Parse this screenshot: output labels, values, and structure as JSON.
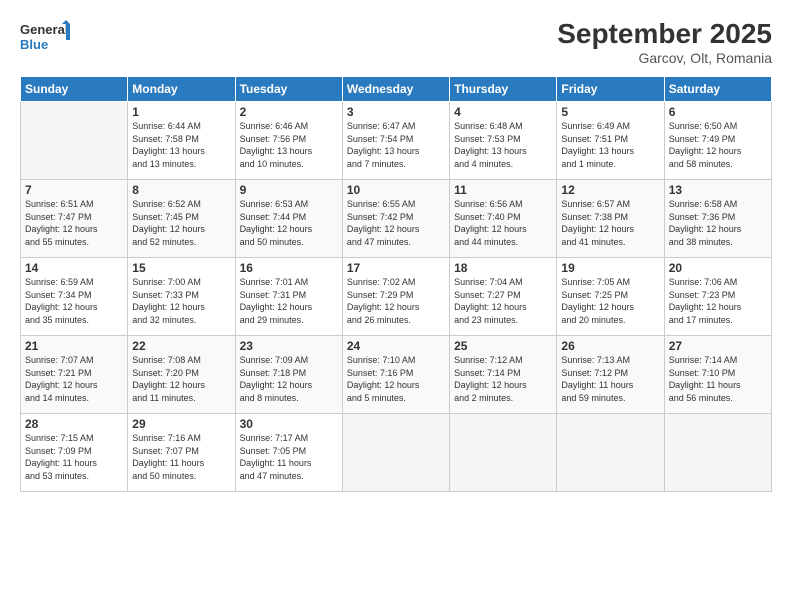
{
  "logo": {
    "line1": "General",
    "line2": "Blue"
  },
  "title": "September 2025",
  "subtitle": "Garcov, Olt, Romania",
  "headers": [
    "Sunday",
    "Monday",
    "Tuesday",
    "Wednesday",
    "Thursday",
    "Friday",
    "Saturday"
  ],
  "weeks": [
    [
      {
        "day": "",
        "info": ""
      },
      {
        "day": "1",
        "info": "Sunrise: 6:44 AM\nSunset: 7:58 PM\nDaylight: 13 hours\nand 13 minutes."
      },
      {
        "day": "2",
        "info": "Sunrise: 6:46 AM\nSunset: 7:56 PM\nDaylight: 13 hours\nand 10 minutes."
      },
      {
        "day": "3",
        "info": "Sunrise: 6:47 AM\nSunset: 7:54 PM\nDaylight: 13 hours\nand 7 minutes."
      },
      {
        "day": "4",
        "info": "Sunrise: 6:48 AM\nSunset: 7:53 PM\nDaylight: 13 hours\nand 4 minutes."
      },
      {
        "day": "5",
        "info": "Sunrise: 6:49 AM\nSunset: 7:51 PM\nDaylight: 13 hours\nand 1 minute."
      },
      {
        "day": "6",
        "info": "Sunrise: 6:50 AM\nSunset: 7:49 PM\nDaylight: 12 hours\nand 58 minutes."
      }
    ],
    [
      {
        "day": "7",
        "info": "Sunrise: 6:51 AM\nSunset: 7:47 PM\nDaylight: 12 hours\nand 55 minutes."
      },
      {
        "day": "8",
        "info": "Sunrise: 6:52 AM\nSunset: 7:45 PM\nDaylight: 12 hours\nand 52 minutes."
      },
      {
        "day": "9",
        "info": "Sunrise: 6:53 AM\nSunset: 7:44 PM\nDaylight: 12 hours\nand 50 minutes."
      },
      {
        "day": "10",
        "info": "Sunrise: 6:55 AM\nSunset: 7:42 PM\nDaylight: 12 hours\nand 47 minutes."
      },
      {
        "day": "11",
        "info": "Sunrise: 6:56 AM\nSunset: 7:40 PM\nDaylight: 12 hours\nand 44 minutes."
      },
      {
        "day": "12",
        "info": "Sunrise: 6:57 AM\nSunset: 7:38 PM\nDaylight: 12 hours\nand 41 minutes."
      },
      {
        "day": "13",
        "info": "Sunrise: 6:58 AM\nSunset: 7:36 PM\nDaylight: 12 hours\nand 38 minutes."
      }
    ],
    [
      {
        "day": "14",
        "info": "Sunrise: 6:59 AM\nSunset: 7:34 PM\nDaylight: 12 hours\nand 35 minutes."
      },
      {
        "day": "15",
        "info": "Sunrise: 7:00 AM\nSunset: 7:33 PM\nDaylight: 12 hours\nand 32 minutes."
      },
      {
        "day": "16",
        "info": "Sunrise: 7:01 AM\nSunset: 7:31 PM\nDaylight: 12 hours\nand 29 minutes."
      },
      {
        "day": "17",
        "info": "Sunrise: 7:02 AM\nSunset: 7:29 PM\nDaylight: 12 hours\nand 26 minutes."
      },
      {
        "day": "18",
        "info": "Sunrise: 7:04 AM\nSunset: 7:27 PM\nDaylight: 12 hours\nand 23 minutes."
      },
      {
        "day": "19",
        "info": "Sunrise: 7:05 AM\nSunset: 7:25 PM\nDaylight: 12 hours\nand 20 minutes."
      },
      {
        "day": "20",
        "info": "Sunrise: 7:06 AM\nSunset: 7:23 PM\nDaylight: 12 hours\nand 17 minutes."
      }
    ],
    [
      {
        "day": "21",
        "info": "Sunrise: 7:07 AM\nSunset: 7:21 PM\nDaylight: 12 hours\nand 14 minutes."
      },
      {
        "day": "22",
        "info": "Sunrise: 7:08 AM\nSunset: 7:20 PM\nDaylight: 12 hours\nand 11 minutes."
      },
      {
        "day": "23",
        "info": "Sunrise: 7:09 AM\nSunset: 7:18 PM\nDaylight: 12 hours\nand 8 minutes."
      },
      {
        "day": "24",
        "info": "Sunrise: 7:10 AM\nSunset: 7:16 PM\nDaylight: 12 hours\nand 5 minutes."
      },
      {
        "day": "25",
        "info": "Sunrise: 7:12 AM\nSunset: 7:14 PM\nDaylight: 12 hours\nand 2 minutes."
      },
      {
        "day": "26",
        "info": "Sunrise: 7:13 AM\nSunset: 7:12 PM\nDaylight: 11 hours\nand 59 minutes."
      },
      {
        "day": "27",
        "info": "Sunrise: 7:14 AM\nSunset: 7:10 PM\nDaylight: 11 hours\nand 56 minutes."
      }
    ],
    [
      {
        "day": "28",
        "info": "Sunrise: 7:15 AM\nSunset: 7:09 PM\nDaylight: 11 hours\nand 53 minutes."
      },
      {
        "day": "29",
        "info": "Sunrise: 7:16 AM\nSunset: 7:07 PM\nDaylight: 11 hours\nand 50 minutes."
      },
      {
        "day": "30",
        "info": "Sunrise: 7:17 AM\nSunset: 7:05 PM\nDaylight: 11 hours\nand 47 minutes."
      },
      {
        "day": "",
        "info": ""
      },
      {
        "day": "",
        "info": ""
      },
      {
        "day": "",
        "info": ""
      },
      {
        "day": "",
        "info": ""
      }
    ]
  ]
}
